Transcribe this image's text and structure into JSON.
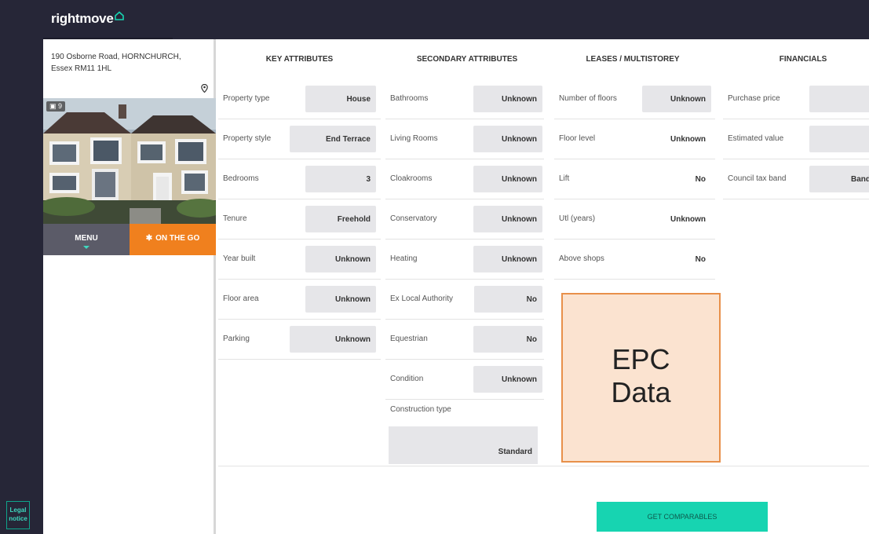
{
  "brand": {
    "logo_text": "rightmove"
  },
  "rail": {
    "legal_line1": "Legal",
    "legal_line2": "notice"
  },
  "property": {
    "address_line1": "190 Osborne Road, HORNCHURCH,",
    "address_line2": "Essex RM11 1HL",
    "photo_count": "9",
    "menu_label": "MENU",
    "on_the_go_label": "ON THE GO"
  },
  "columns": {
    "key": "KEY ATTRIBUTES",
    "secondary": "SECONDARY ATTRIBUTES",
    "leases": "LEASES / MULTISTOREY",
    "financials": "FINANCIALS"
  },
  "key_attributes": [
    {
      "label": "Property type",
      "value": "House"
    },
    {
      "label": "Property style",
      "value": "End Terrace"
    },
    {
      "label": "Bedrooms",
      "value": "3"
    },
    {
      "label": "Tenure",
      "value": "Freehold"
    },
    {
      "label": "Year built",
      "value": "Unknown"
    },
    {
      "label": "Floor area",
      "value": "Unknown"
    },
    {
      "label": "Parking",
      "value": "Unknown"
    }
  ],
  "secondary_attributes": [
    {
      "label": "Bathrooms",
      "value": "Unknown"
    },
    {
      "label": "Living Rooms",
      "value": "Unknown"
    },
    {
      "label": "Cloakrooms",
      "value": "Unknown"
    },
    {
      "label": "Conservatory",
      "value": "Unknown"
    },
    {
      "label": "Heating",
      "value": "Unknown"
    },
    {
      "label": "Ex Local Authority",
      "value": "No"
    },
    {
      "label": "Equestrian",
      "value": "No"
    },
    {
      "label": "Condition",
      "value": "Unknown"
    }
  ],
  "construction": {
    "label": "Construction type",
    "value": "Standard"
  },
  "leases": [
    {
      "label": "Number of floors",
      "value": "Unknown"
    },
    {
      "label": "Floor level",
      "value": "Unknown"
    },
    {
      "label": "Lift",
      "value": "No"
    },
    {
      "label": "Utl (years)",
      "value": "Unknown"
    },
    {
      "label": "Above shops",
      "value": "No"
    }
  ],
  "financials": [
    {
      "label": "Purchase price",
      "value": ""
    },
    {
      "label": "Estimated value",
      "value": ""
    },
    {
      "label": "Council tax band",
      "value": "Band"
    }
  ],
  "epc": {
    "line1": "EPC",
    "line2": "Data"
  },
  "actions": {
    "get_comparables": "GET COMPARABLES"
  },
  "colors": {
    "navy": "#262637",
    "accent_teal": "#17d4b1",
    "orange": "#f0801e",
    "epc_fill": "#fbe3d0",
    "epc_border": "#e8904a"
  }
}
